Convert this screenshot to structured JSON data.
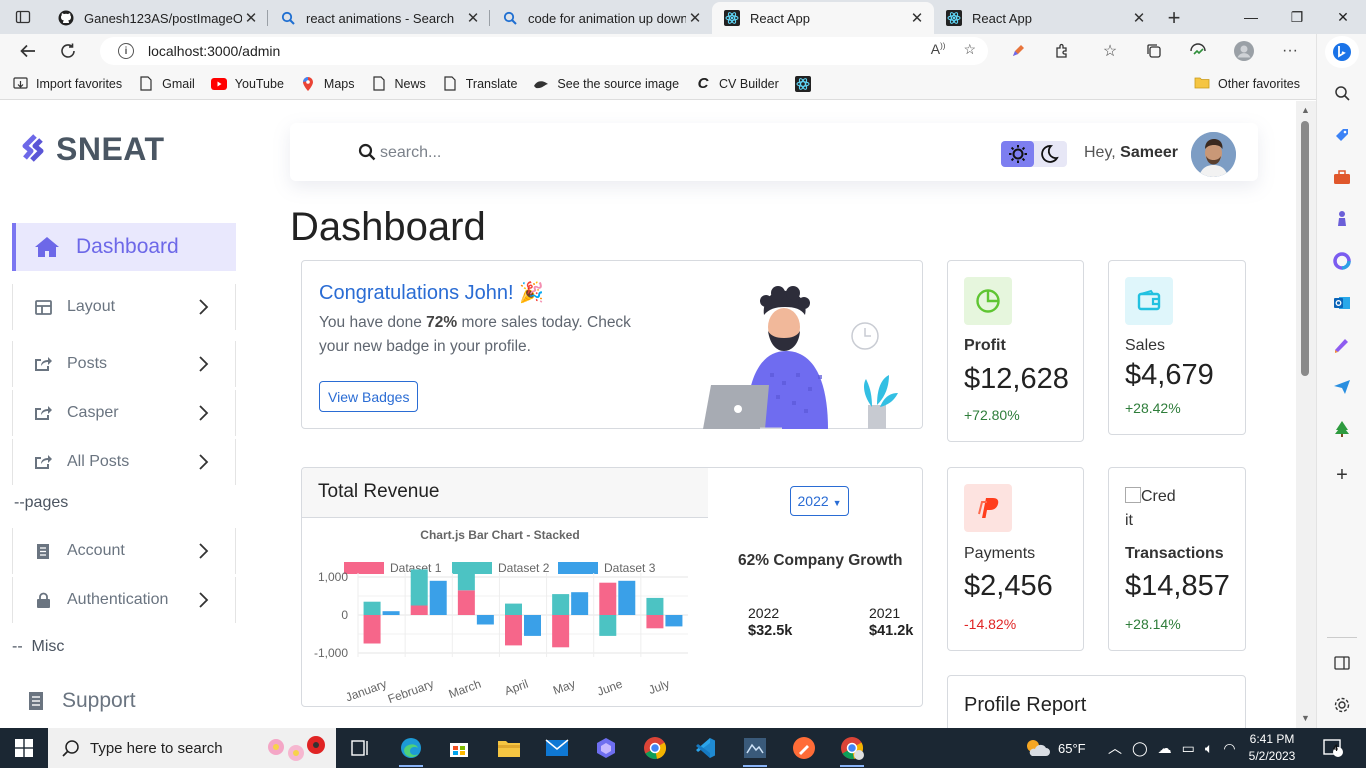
{
  "browser": {
    "tabs": [
      {
        "title": "Ganesh123AS/postImageOnly",
        "icon": "github-icon"
      },
      {
        "title": "react animations - Search",
        "icon": "search-icon"
      },
      {
        "title": "code for animation up down",
        "icon": "search-icon"
      },
      {
        "title": "React App",
        "icon": "react-icon",
        "active": true
      },
      {
        "title": "React App",
        "icon": "react-icon"
      }
    ],
    "url": "localhost:3000/admin",
    "favorites": [
      {
        "label": "Import favorites"
      },
      {
        "label": "Gmail"
      },
      {
        "label": "YouTube"
      },
      {
        "label": "Maps"
      },
      {
        "label": "News"
      },
      {
        "label": "Translate"
      },
      {
        "label": "See the source image"
      },
      {
        "label": "CV Builder"
      }
    ],
    "other_favorites": "Other favorites"
  },
  "app": {
    "brand": "SNEAT",
    "nav": {
      "dashboard": "Dashboard",
      "layout": "Layout",
      "posts": "Posts",
      "casper": "Casper",
      "all_posts": "All Posts",
      "pages_header": "--pages",
      "account": "Account",
      "authentication": "Authentication",
      "misc_header": "--  Misc",
      "support": "Support"
    },
    "search": {
      "placeholder": "search..."
    },
    "greeting": {
      "prefix": "Hey, ",
      "name": "Sameer"
    },
    "page_title": "Dashboard",
    "congrats": {
      "title": "Congratulations John! 🎉",
      "text_before": "You have done ",
      "percent": "72%",
      "text_after": " more sales today. Check your new badge in your profile.",
      "button": "View Badges"
    },
    "stats": {
      "profit": {
        "label": "Profit",
        "value": "$12,628",
        "change": "+72.80%"
      },
      "sales": {
        "label": "Sales",
        "value": "$4,679",
        "change": "+28.42%"
      },
      "payments": {
        "label": "Payments",
        "value": "$2,456",
        "change": "-14.82%"
      },
      "transactions": {
        "broken_img_alt": "Credit",
        "label": "Transactions",
        "value": "$14,857",
        "change": "+28.14%"
      }
    },
    "revenue": {
      "title": "Total Revenue",
      "year_select": "2022",
      "growth": "62% Company Growth",
      "year_a": {
        "year": "2022",
        "value": "$32.5k"
      },
      "year_b": {
        "year": "2021",
        "value": "$41.2k"
      }
    },
    "profile_report": "Profile Report",
    "colors": {
      "accent": "#6d68e8",
      "link": "#2a6cd4",
      "positive": "#2e7d3a",
      "negative": "#e02424"
    }
  },
  "chart_data": {
    "type": "bar",
    "stacked": true,
    "title": "Chart.js Bar Chart - Stacked",
    "categories": [
      "January",
      "February",
      "March",
      "April",
      "May",
      "June",
      "July"
    ],
    "series": [
      {
        "name": "Dataset 1",
        "color": "#f6668a",
        "values": [
          -750,
          250,
          650,
          -800,
          -850,
          850,
          -350
        ]
      },
      {
        "name": "Dataset 2",
        "color": "#4cc3c3",
        "values": [
          350,
          950,
          650,
          300,
          550,
          -550,
          450
        ]
      },
      {
        "name": "Dataset 3",
        "color": "#3aa0e8",
        "values": [
          100,
          900,
          -250,
          -550,
          600,
          900,
          -300
        ]
      }
    ],
    "ylim": [
      -1000,
      1000
    ],
    "ytick_labels": [
      "1,000",
      "0",
      "-1,000"
    ],
    "legend": "top"
  },
  "taskbar": {
    "search_placeholder": "Type here to search",
    "weather": "65°F",
    "time": "6:41 PM",
    "date": "5/2/2023",
    "notifications": "4"
  }
}
